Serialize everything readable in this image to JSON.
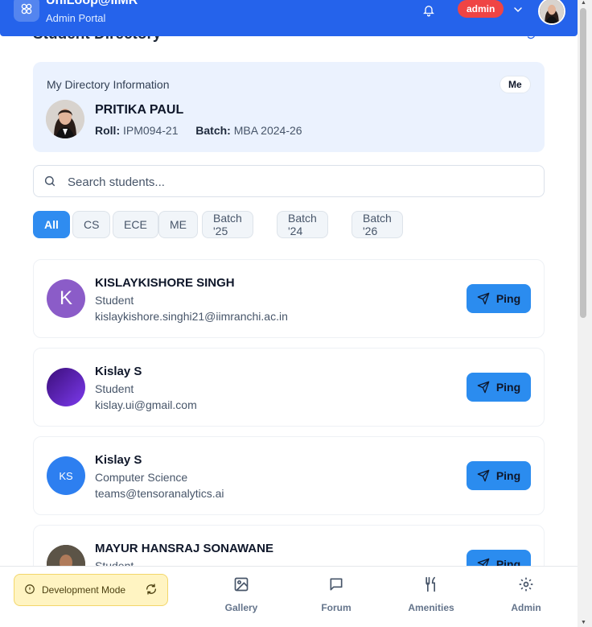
{
  "header": {
    "app_title": "UniLoop@IIMR",
    "app_subtitle": "Admin Portal",
    "role_badge": "admin"
  },
  "page": {
    "title": "Student Directory"
  },
  "my_info": {
    "label": "My Directory Information",
    "me_badge": "Me",
    "name": "PRITIKA PAUL",
    "roll_label": "Roll:",
    "roll": "IPM094-21",
    "batch_label": "Batch:",
    "batch": "MBA 2024-26"
  },
  "search": {
    "placeholder": "Search students..."
  },
  "filters": [
    "All",
    "CS",
    "ECE",
    "ME",
    "Batch '25",
    "Batch '24",
    "Batch '26"
  ],
  "students": [
    {
      "name": "KISLAYKISHORE SINGH",
      "role": "Student",
      "email": "kislaykishore.singhi21@iimranchi.ac.in",
      "initials": "K",
      "avatar_color": "#8b5cc8",
      "ping": "Ping"
    },
    {
      "name": "Kislay S",
      "role": "Student",
      "email": "kislay.ui@gmail.com",
      "initials": "",
      "avatar_color": "#5b21b6",
      "ping": "Ping"
    },
    {
      "name": "Kislay S",
      "role": "Computer Science",
      "email": "teams@tensoranalytics.ai",
      "initials": "KS",
      "avatar_color": "#2d7ff0",
      "ping": "Ping"
    },
    {
      "name": "MAYUR HANSRAJ SONAWANE",
      "role": "Student",
      "email": "",
      "initials": "",
      "avatar_color": "#3b3a34",
      "ping": "Ping"
    }
  ],
  "dev_mode": {
    "label": "Development Mode"
  },
  "bottom_nav": [
    {
      "label": "Gallery",
      "icon": "image-icon"
    },
    {
      "label": "Forum",
      "icon": "message-icon"
    },
    {
      "label": "Amenities",
      "icon": "utensils-icon"
    },
    {
      "label": "Admin",
      "icon": "gear-icon"
    }
  ],
  "colors": {
    "primary": "#2563eb",
    "accent_button": "#2b8cef",
    "admin_badge": "#ef4444",
    "my_info_bg": "#ebf2fe"
  }
}
